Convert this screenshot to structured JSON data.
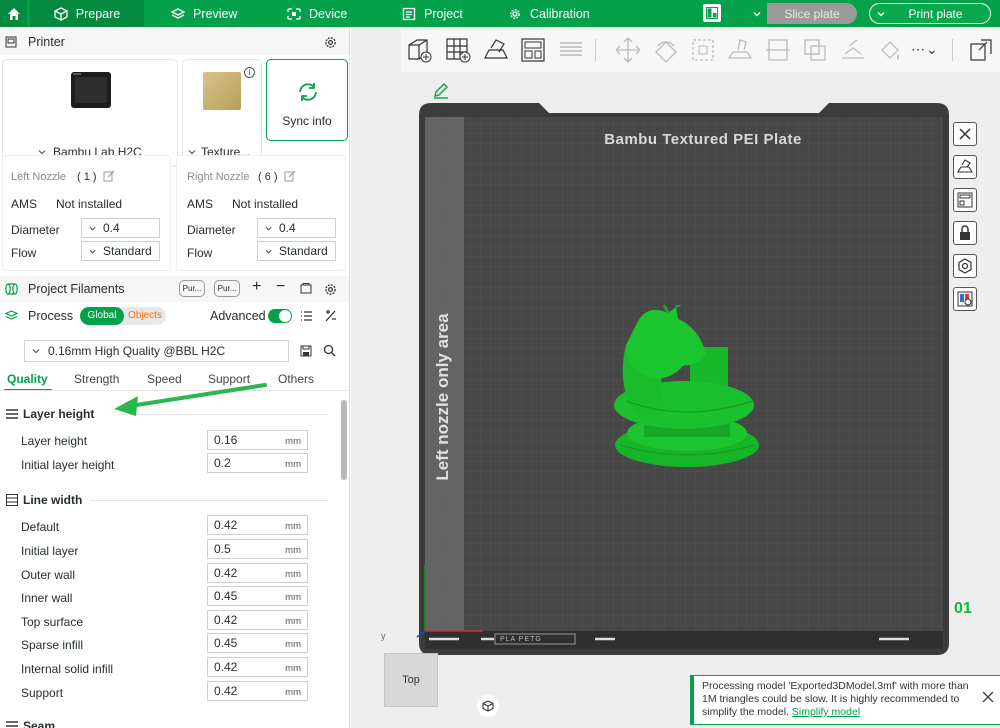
{
  "topbar": {
    "tabs": [
      {
        "label": "Prepare"
      },
      {
        "label": "Preview"
      },
      {
        "label": "Device"
      },
      {
        "label": "Project"
      },
      {
        "label": "Calibration"
      }
    ],
    "slice_label": "Slice plate",
    "print_label": "Print plate"
  },
  "printer": {
    "section_label": "Printer",
    "name": "Bambu Lab H2C",
    "plate": "Texture...",
    "sync_label": "Sync info"
  },
  "nozzles": {
    "left": {
      "title": "Left Nozzle",
      "count": "( 1 )",
      "ams_label": "AMS",
      "ams_value": "Not installed",
      "diameter_label": "Diameter",
      "diameter_value": "0.4",
      "flow_label": "Flow",
      "flow_value": "Standard"
    },
    "right": {
      "title": "Right Nozzle",
      "count": "( 6 )",
      "ams_label": "AMS",
      "ams_value": "Not installed",
      "diameter_label": "Diameter",
      "diameter_value": "0.4",
      "flow_label": "Flow",
      "flow_value": "Standard"
    }
  },
  "filaments": {
    "label": "Project Filaments",
    "chip1": "Pur...",
    "chip2": "Pur..."
  },
  "process": {
    "label": "Process",
    "global_label": "Global",
    "objects_label": "Objects",
    "advanced_label": "Advanced",
    "preset": "0.16mm High Quality @BBL H2C"
  },
  "tabs": [
    {
      "label": "Quality"
    },
    {
      "label": "Strength"
    },
    {
      "label": "Speed"
    },
    {
      "label": "Support"
    },
    {
      "label": "Others"
    }
  ],
  "groups": {
    "layer_height": {
      "title": "Layer height",
      "rows": [
        {
          "label": "Layer height",
          "value": "0.16",
          "unit": "mm"
        },
        {
          "label": "Initial layer height",
          "value": "0.2",
          "unit": "mm"
        }
      ]
    },
    "line_width": {
      "title": "Line width",
      "rows": [
        {
          "label": "Default",
          "value": "0.42",
          "unit": "mm"
        },
        {
          "label": "Initial layer",
          "value": "0.5",
          "unit": "mm"
        },
        {
          "label": "Outer wall",
          "value": "0.42",
          "unit": "mm"
        },
        {
          "label": "Inner wall",
          "value": "0.45",
          "unit": "mm"
        },
        {
          "label": "Top surface",
          "value": "0.42",
          "unit": "mm"
        },
        {
          "label": "Sparse infill",
          "value": "0.45",
          "unit": "mm"
        },
        {
          "label": "Internal solid infill",
          "value": "0.42",
          "unit": "mm"
        },
        {
          "label": "Support",
          "value": "0.42",
          "unit": "mm"
        }
      ]
    },
    "seam": {
      "title": "Seam"
    }
  },
  "viewport": {
    "plate_title": "Bambu Textured PEI Plate",
    "left_nozzle_area": "Left nozzle only area",
    "plate_number": "01",
    "plate_code": "PLA PETG",
    "view_label": "Top",
    "axis_y": "y"
  },
  "notification": {
    "text": "Processing model 'Exported3DModel.3mf' with more than 1M triangles could be slow. It is highly recommended to simplify the model.",
    "link": "Simplify model"
  },
  "colors": {
    "accent": "#05a14a",
    "model": "#18c22c",
    "link": "#05a14a",
    "plate_dark": "#3c3c3c",
    "grid": "#4a4a4a"
  }
}
